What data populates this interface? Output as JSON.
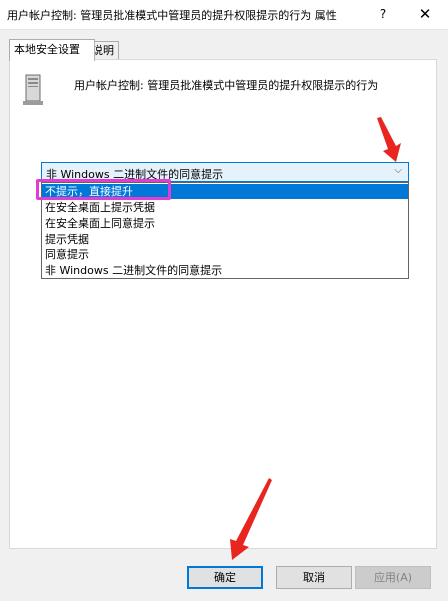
{
  "window": {
    "title": "用户帐户控制: 管理员批准模式中管理员的提升权限提示的行为 属性",
    "help_label": "?",
    "close_label": "✕"
  },
  "tabs": [
    {
      "label": "本地安全设置",
      "active": true
    },
    {
      "label": "说明",
      "active": false
    }
  ],
  "policy": {
    "icon": "computer-icon",
    "description": "用户帐户控制: 管理员批准模式中管理员的提升权限提示的行为"
  },
  "combo": {
    "value": "非 Windows 二进制文件的同意提示",
    "arrow": "⌵"
  },
  "dropdown": {
    "options": [
      {
        "label": "不提示，直接提升",
        "selected": true
      },
      {
        "label": "在安全桌面上提示凭据",
        "selected": false
      },
      {
        "label": "在安全桌面上同意提示",
        "selected": false
      },
      {
        "label": "提示凭据",
        "selected": false
      },
      {
        "label": "同意提示",
        "selected": false
      },
      {
        "label": "非 Windows 二进制文件的同意提示",
        "selected": false
      }
    ]
  },
  "annotations": {
    "highlight_color": "#e23dd1",
    "arrow_color": "#e8261f"
  },
  "buttons": {
    "ok": "确定",
    "cancel": "取消",
    "apply": "应用(A)"
  },
  "colors": {
    "accent": "#0078d7",
    "dialog_bg": "#f0f0f0",
    "panel_bg": "#ffffff"
  }
}
